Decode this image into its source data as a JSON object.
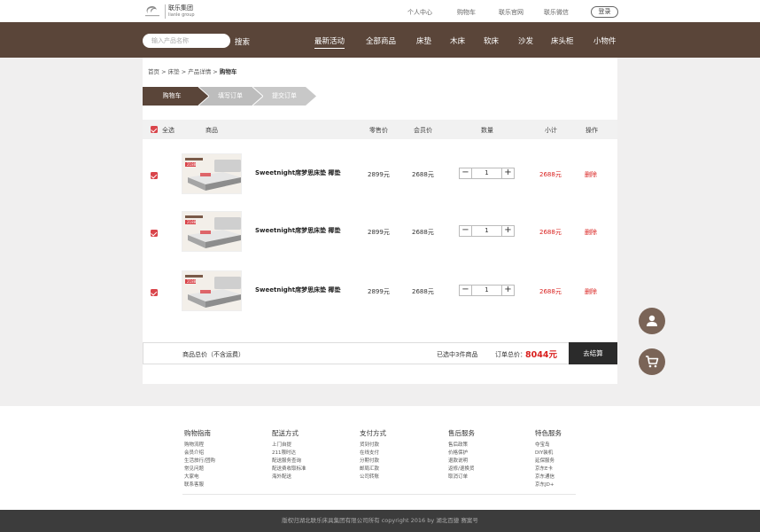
{
  "header": {
    "brand_cn": "联乐集团",
    "brand_en": "lianle group",
    "links": [
      "个人中心",
      "购物车",
      "联乐官网",
      "联乐微信"
    ],
    "login_label": "登录"
  },
  "nav": {
    "search_placeholder": "输入产品名称",
    "search_label": "搜索",
    "items": [
      "最新活动",
      "全部商品",
      "床垫",
      "木床",
      "软床",
      "沙发",
      "床头柜",
      "小物件"
    ],
    "active_index": 0
  },
  "breadcrumb": {
    "items": [
      "首页",
      "床垫",
      "产品详情"
    ],
    "separator": ">",
    "current": "购物车"
  },
  "steps": [
    "购物车",
    "填写订单",
    "提交订单"
  ],
  "table": {
    "select_all_label": "全选",
    "headers": {
      "product": "商品",
      "retail_price": "零售价",
      "member_price": "会员价",
      "quantity": "数量",
      "subtotal": "小计",
      "action": "操作"
    }
  },
  "cart_items": [
    {
      "name": "Sweetnight席梦思床垫 椰垫",
      "retail_price": "2899元",
      "member_price": "2688元",
      "quantity": "1",
      "subtotal": "2688元",
      "delete_label": "删除",
      "checked": true,
      "img_price_tag": "2188"
    },
    {
      "name": "Sweetnight席梦思床垫 椰垫",
      "retail_price": "2899元",
      "member_price": "2688元",
      "quantity": "1",
      "subtotal": "2688元",
      "delete_label": "删除",
      "checked": true,
      "img_price_tag": "2188"
    },
    {
      "name": "Sweetnight席梦思床垫 椰垫",
      "retail_price": "2899元",
      "member_price": "2688元",
      "quantity": "1",
      "subtotal": "2688元",
      "delete_label": "删除",
      "checked": true,
      "img_price_tag": "2188"
    }
  ],
  "summary": {
    "total_label": "商品总价（不含运费）",
    "selected_count": "已选中3件商品",
    "order_total_label": "订单总价：",
    "order_total": "8044元",
    "checkout_label": "去结算"
  },
  "footer": {
    "columns": [
      {
        "title": "购物指南",
        "items": [
          "购物流程",
          "会员介绍",
          "生活旅行/团购",
          "常见问题",
          "大家电",
          "联系客服"
        ]
      },
      {
        "title": "配送方式",
        "items": [
          "上门自提",
          "211限时达",
          "配送服务查询",
          "配送费收取标准",
          "海外配送"
        ]
      },
      {
        "title": "支付方式",
        "items": [
          "货到付款",
          "在线支付",
          "分期付款",
          "邮局汇款",
          "公司转账"
        ]
      },
      {
        "title": "售后服务",
        "items": [
          "售后政策",
          "价格保护",
          "退款说明",
          "返修/退换货",
          "取消订单"
        ]
      },
      {
        "title": "特色服务",
        "items": [
          "夺宝岛",
          "DIY装机",
          "延保服务",
          "京东E卡",
          "京东通信",
          "京东JD+"
        ]
      }
    ],
    "copyright": "版权归湖北联乐床具集团有限公司所有 copyright 2016 by 湖北百捷 赛案号"
  },
  "colors": {
    "brand_brown": "#5a4539",
    "accent_red": "#d9444a",
    "price_red": "#d9201e",
    "checkout_dark": "#2b2b2b",
    "step_active": "#5a4539",
    "step_inactive": "#c8c8c8"
  },
  "icons": {
    "float_user": "user-icon",
    "float_cart": "cart-icon"
  }
}
